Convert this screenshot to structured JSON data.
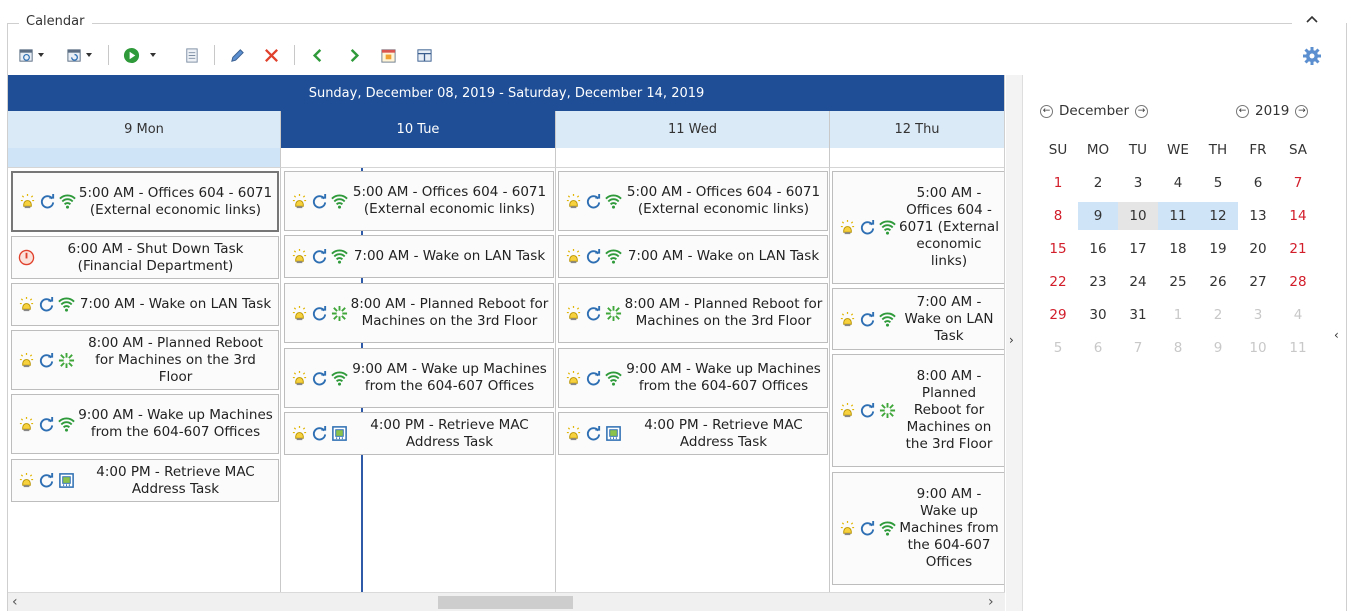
{
  "panel": {
    "title": "Calendar"
  },
  "scheduler": {
    "range_label": "Sunday, December 08, 2019 - Saturday, December 14, 2019",
    "days": [
      {
        "label": "9 Mon"
      },
      {
        "label": "10 Tue"
      },
      {
        "label": "11 Wed"
      },
      {
        "label": "12 Thu"
      }
    ],
    "appointments": [
      {
        "text": "5:00 AM - Offices 604 - 6071 (External economic links)",
        "icons": [
          "light",
          "sync",
          "wifi"
        ]
      },
      {
        "text": "6:00 AM - Shut Down Task (Financial Department)",
        "icons": [
          "power"
        ]
      },
      {
        "text": "7:00 AM - Wake on LAN Task",
        "icons": [
          "light",
          "sync",
          "wifi"
        ]
      },
      {
        "text": "8:00 AM - Planned Reboot for Machines on the 3rd Floor",
        "icons": [
          "light",
          "sync",
          "reboot"
        ]
      },
      {
        "text": "9:00 AM - Wake up Machines from the 604-607 Offices",
        "icons": [
          "light",
          "sync",
          "wifi"
        ]
      },
      {
        "text": "4:00 PM - Retrieve MAC Address Task",
        "icons": [
          "light",
          "sync",
          "mac"
        ]
      },
      {
        "text": "5:00 AM - Offices 604 - 6071 (External economic links)",
        "icons": [
          "light",
          "sync",
          "wifi"
        ]
      },
      {
        "text": "7:00 AM - Wake on LAN Task",
        "icons": [
          "light",
          "sync",
          "wifi"
        ]
      },
      {
        "text": "8:00 AM - Planned Reboot for Machines on the 3rd Floor",
        "icons": [
          "light",
          "sync",
          "reboot"
        ]
      },
      {
        "text": "9:00 AM - Wake up Machines from the 604-607 Offices",
        "icons": [
          "light",
          "sync",
          "wifi"
        ]
      },
      {
        "text": "4:00 PM - Retrieve MAC Address Task",
        "icons": [
          "light",
          "sync",
          "mac"
        ]
      },
      {
        "text": "5:00 AM - Offices 604 - 6071 (External economic links)",
        "icons": [
          "light",
          "sync",
          "wifi"
        ]
      },
      {
        "text": "7:00 AM - Wake on LAN Task",
        "icons": [
          "light",
          "sync",
          "wifi"
        ]
      },
      {
        "text": "8:00 AM - Planned Reboot for Machines on the 3rd Floor",
        "icons": [
          "light",
          "sync",
          "reboot"
        ]
      },
      {
        "text": "9:00 AM - Wake up Machines from the 604-607 Offices",
        "icons": [
          "light",
          "sync",
          "wifi"
        ]
      },
      {
        "text": "4:00 PM - Retrieve MAC Address Task",
        "icons": [
          "light",
          "sync",
          "mac"
        ]
      },
      {
        "text": "5:00 AM - Offices 604 - 6071 (External economic links)",
        "icons": [
          "light",
          "sync",
          "wifi"
        ]
      },
      {
        "text": "7:00 AM - Wake on LAN Task",
        "icons": [
          "light",
          "sync",
          "wifi"
        ]
      },
      {
        "text": "8:00 AM - Planned Reboot for Machines on the 3rd Floor",
        "icons": [
          "light",
          "sync",
          "reboot"
        ]
      },
      {
        "text": "9:00 AM - Wake up Machines from the 604-607 Offices",
        "icons": [
          "light",
          "sync",
          "wifi"
        ]
      }
    ]
  },
  "mini_calendar": {
    "month": "December",
    "year": "2019",
    "weekdays": [
      "SU",
      "MO",
      "TU",
      "WE",
      "TH",
      "FR",
      "SA"
    ],
    "weeks": [
      [
        "1",
        "2",
        "3",
        "4",
        "5",
        "6",
        "7"
      ],
      [
        "8",
        "9",
        "10",
        "11",
        "12",
        "13",
        "14"
      ],
      [
        "15",
        "16",
        "17",
        "18",
        "19",
        "20",
        "21"
      ],
      [
        "22",
        "23",
        "24",
        "25",
        "26",
        "27",
        "28"
      ],
      [
        "29",
        "30",
        "31",
        "1",
        "2",
        "3",
        "4"
      ],
      [
        "5",
        "6",
        "7",
        "8",
        "9",
        "10",
        "11"
      ]
    ]
  },
  "colors": {
    "header_blue": "#1f4e96",
    "day_header_light": "#dbeaf7",
    "weekend_red": "#d21e2b",
    "selected_day": "#cfe4f7"
  }
}
